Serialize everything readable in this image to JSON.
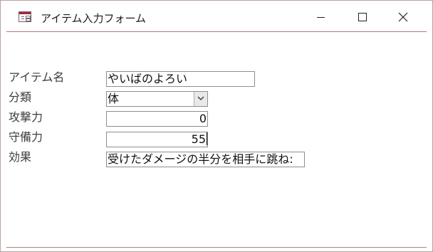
{
  "window": {
    "title": "アイテム入力フォーム",
    "icon": "form-icon",
    "controls": {
      "minimize": "minimize-icon",
      "maximize": "maximize-icon",
      "close": "close-icon"
    }
  },
  "form": {
    "fields": [
      {
        "label": "アイテム名",
        "value": "やいばのよろい"
      },
      {
        "label": "分類",
        "value": "体"
      },
      {
        "label": "攻撃力",
        "value": "0"
      },
      {
        "label": "守備力",
        "value": "55"
      },
      {
        "label": "効果",
        "value": "受けたダメージの半分を相手に跳ね:"
      }
    ]
  }
}
